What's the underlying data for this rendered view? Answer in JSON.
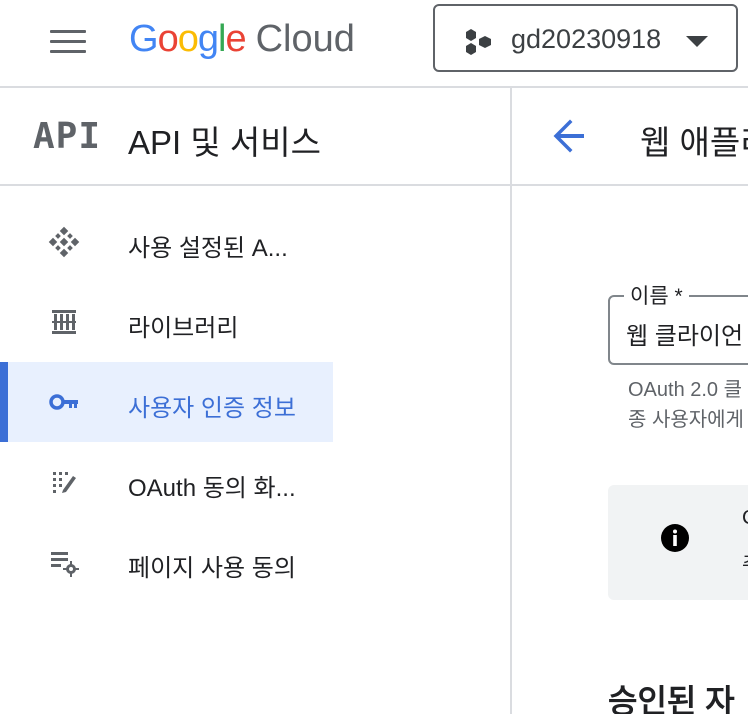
{
  "topbar": {
    "logo_letters": [
      "G",
      "o",
      "o",
      "g",
      "l",
      "e"
    ],
    "logo_colors": [
      "#4285F4",
      "#EA4335",
      "#FBBC05",
      "#4285F4",
      "#34A853",
      "#EA4335"
    ],
    "logo_cloud": "Cloud",
    "project_name": "gd20230918",
    "menu_icon": "hamburger-menu-icon",
    "dropdown_icon": "caret-down-icon"
  },
  "sidebar": {
    "logo_text": "API",
    "title": "API 및 서비스",
    "items": [
      {
        "label": "사용 설정된 A...",
        "icon": "enabled-apis-icon"
      },
      {
        "label": "라이브러리",
        "icon": "library-icon"
      },
      {
        "label": "사용자 인증 정보",
        "icon": "key-icon",
        "active": true
      },
      {
        "label": "OAuth 동의 화...",
        "icon": "oauth-consent-icon"
      },
      {
        "label": "페이지 사용 동의",
        "icon": "page-agreement-icon"
      }
    ]
  },
  "main": {
    "title": "웹 애플리",
    "name_field": {
      "label": "이름 *",
      "value": "웹 클라이언"
    },
    "helper_lines": [
      "OAuth 2.0 클",
      "종 사용자에게"
    ],
    "info_lines": [
      "C",
      "추"
    ],
    "section_heading": "승인된 자"
  },
  "colors": {
    "accent": "#3c6fd6",
    "active_bg": "#e8f0fe",
    "divider": "#dadce0"
  }
}
